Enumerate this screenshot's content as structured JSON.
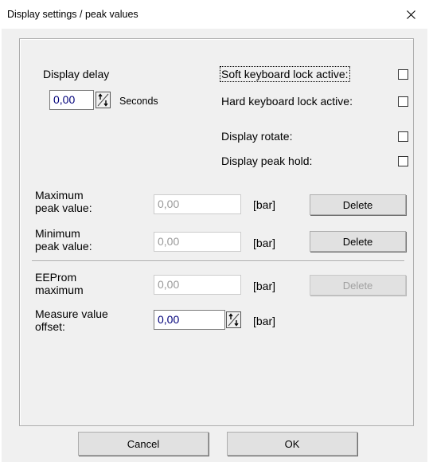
{
  "window": {
    "title": "Display settings / peak values"
  },
  "display_delay": {
    "label": "Display delay",
    "value": "0,00",
    "unit": "Seconds"
  },
  "options": [
    {
      "label": "Soft keyboard lock active:",
      "checked": false
    },
    {
      "label": "Hard keyboard lock active:",
      "checked": false
    },
    {
      "label": "Display rotate:",
      "checked": false
    },
    {
      "label": "Display peak hold:",
      "checked": false
    }
  ],
  "max_peak": {
    "label": "Maximum\npeak value:",
    "value": "0,00",
    "unit": "[bar]",
    "button": "Delete"
  },
  "min_peak": {
    "label": "Minimum\npeak value:",
    "value": "0,00",
    "unit": "[bar]",
    "button": "Delete"
  },
  "eeprom": {
    "label": "EEProm\nmaximum",
    "value": "0,00",
    "unit": "[bar]",
    "button": "Delete"
  },
  "offset": {
    "label": "Measure value\noffset:",
    "value": "0,00",
    "unit": "[bar]"
  },
  "footer": {
    "cancel": "Cancel",
    "ok": "OK"
  }
}
